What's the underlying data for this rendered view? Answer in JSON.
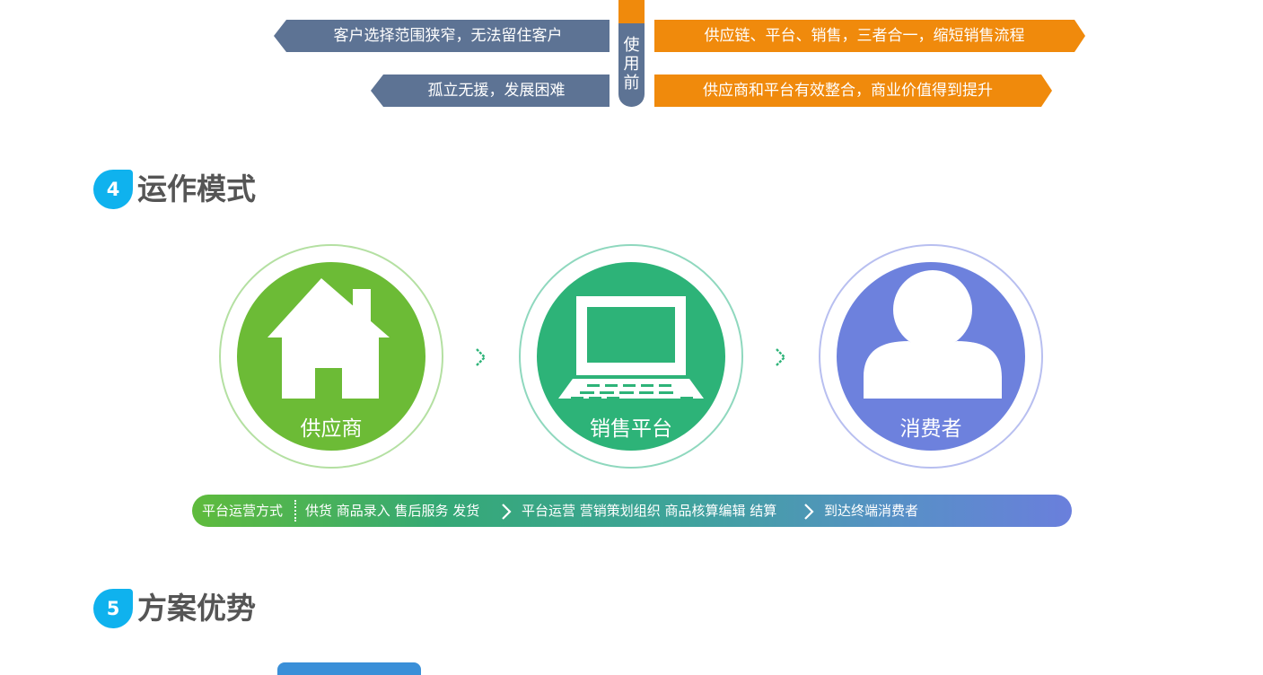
{
  "comparison": {
    "before_label": [
      "使",
      "用",
      "前"
    ],
    "left": [
      "客户选择范围狭窄，无法留住客户",
      "孤立无援，发展困难"
    ],
    "right": [
      "供应链、平台、销售，三者合一，缩短销售流程",
      "供应商和平台有效整合，商业价值得到提升"
    ],
    "colors": {
      "left": "#5d7394",
      "right": "#f08a0c"
    }
  },
  "section4": {
    "number": "4",
    "title": "运作模式"
  },
  "circles": [
    {
      "label": "供应商",
      "icon": "house-icon",
      "color": "#6cbb36"
    },
    {
      "label": "销售平台",
      "icon": "laptop-icon",
      "color": "#2db378"
    },
    {
      "label": "消费者",
      "icon": "person-icon",
      "color": "#6d81dd"
    }
  ],
  "flow": {
    "title": "平台运营方式",
    "steps": [
      "供货 商品录入 售后服务 发货",
      "平台运营 营销策划组织 商品核算编辑 结算",
      "到达终端消费者"
    ]
  },
  "section5": {
    "number": "5",
    "title": "方案优势"
  },
  "accent": "#0fb2ee"
}
